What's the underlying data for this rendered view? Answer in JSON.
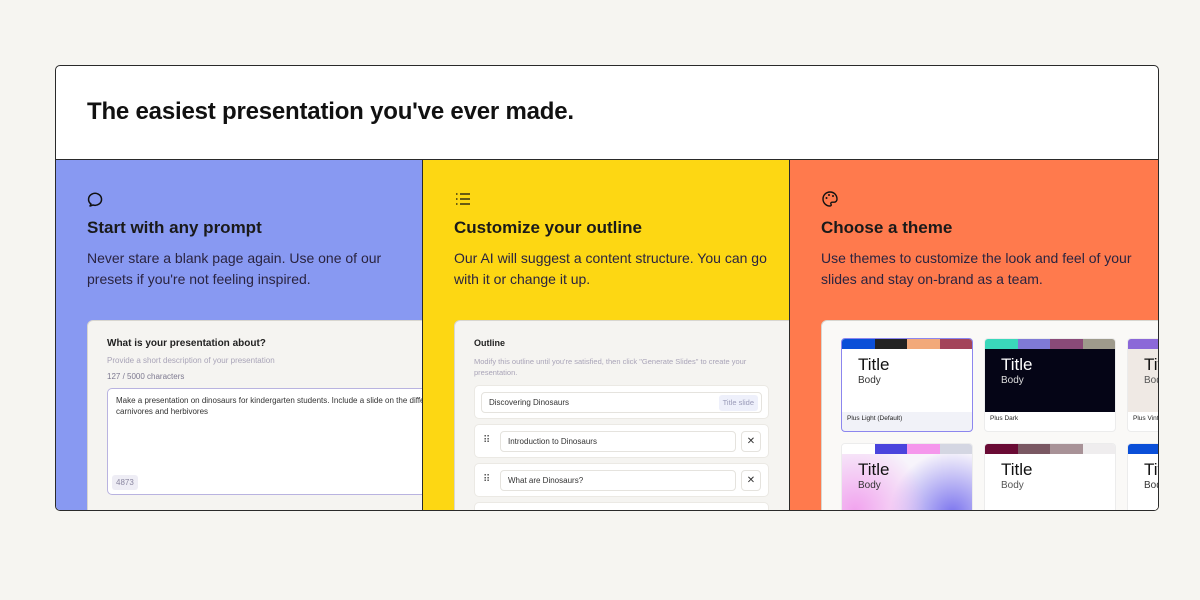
{
  "heading": "The easiest presentation you've ever made.",
  "colors": {
    "prompt": "#8899f2",
    "outline": "#fdd713",
    "theme": "#ff7a4d"
  },
  "columns": [
    {
      "icon": "chat-bubble-icon",
      "title": "Start with any prompt",
      "desc": "Never stare a blank page again. Use one of our presets if you're not feeling inspired."
    },
    {
      "icon": "list-icon",
      "title": "Customize your outline",
      "desc": "Our AI will suggest a content structure. You can go with it or change it up."
    },
    {
      "icon": "palette-icon",
      "title": "Choose a theme",
      "desc": "Use themes to customize the look and feel of your slides and stay on-brand as a team."
    }
  ],
  "prompt_panel": {
    "question": "What is your presentation about?",
    "hint": "Provide a short description of your presentation",
    "count": "127 / 5000 characters",
    "value": "Make a presentation on dinosaurs for kindergarten students. Include a slide on the difference between carnivores and herbivores",
    "remaining": "4873"
  },
  "outline_panel": {
    "title": "Outline",
    "hint": "Modify this outline until you're satisfied, then click \"Generate Slides\" to create your presentation.",
    "title_slide": "Discovering Dinosaurs",
    "title_tag": "Title slide",
    "items": [
      "Introduction to Dinosaurs",
      "What are Dinosaurs?"
    ],
    "remove": "✕",
    "drag": "⠿"
  },
  "themes": [
    {
      "name": "Plus Light (Default)",
      "title": "Title",
      "body": "Body",
      "colors": [
        "#0a4fd8",
        "#222222",
        "#f2a97a",
        "#a3445a"
      ]
    },
    {
      "name": "Plus Dark",
      "title": "Title",
      "body": "Body",
      "colors": [
        "#3ad8bb",
        "#7f7ad6",
        "#8a4a78",
        "#9e9a8c"
      ]
    },
    {
      "name": "Plus Vintage",
      "title": "Title",
      "body": "Body",
      "colors": [
        "#8b68d8",
        "#8b68d8",
        "#8b68d8",
        "#8b68d8"
      ]
    },
    {
      "name": "",
      "title": "Title",
      "body": "Body",
      "colors": [
        "#ffffff",
        "#4a44dd",
        "#f597ec",
        "#d4d6e2"
      ]
    },
    {
      "name": "",
      "title": "Title",
      "body": "Body",
      "colors": [
        "#6a0b35",
        "#7a5863",
        "#a89297",
        "#efedee"
      ]
    },
    {
      "name": "",
      "title": "Title",
      "body": "Body",
      "colors": [
        "#0a4fd8",
        "#0a4fd8",
        "#0a4fd8",
        "#0a4fd8"
      ]
    }
  ]
}
